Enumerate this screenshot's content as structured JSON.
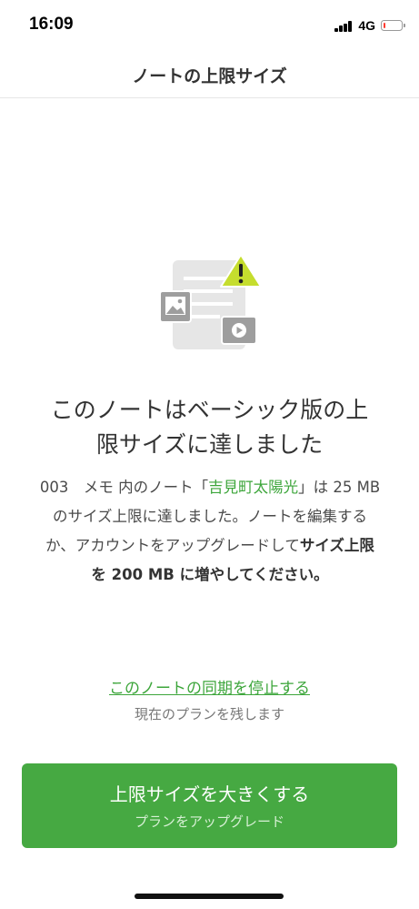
{
  "status_bar": {
    "time": "16:09",
    "network": "4G",
    "icons": [
      "signal-icon",
      "battery-icon"
    ],
    "battery_level": 0.1
  },
  "header": {
    "title": "ノートの上限サイズ"
  },
  "illustration": {
    "icons": [
      "note-document-icon",
      "warning-icon",
      "image-icon",
      "video-icon"
    ]
  },
  "main": {
    "headline_line1": "このノートはベーシック版の上",
    "headline_line2": "限サイズに達しました",
    "body_part1": "003　メモ 内のノート「",
    "note_name": "吉見町太陽光",
    "body_part2": "」は 25 MB のサイズ上限に達しました。ノートを編集するか、アカウントをアップグレードして",
    "body_bold": "サイズ上限を 200 MB に増やしてください。"
  },
  "stop_sync": {
    "link_label": "このノートの同期を停止する",
    "sub_label": "現在のプランを残します"
  },
  "upgrade": {
    "label": "上限サイズを大きくする",
    "sub_label": "プランをアップグレード"
  },
  "colors": {
    "accent": "#46a942",
    "link": "#3da63b",
    "warning": "#c5dd2e",
    "battery_low": "#ff3b30"
  }
}
